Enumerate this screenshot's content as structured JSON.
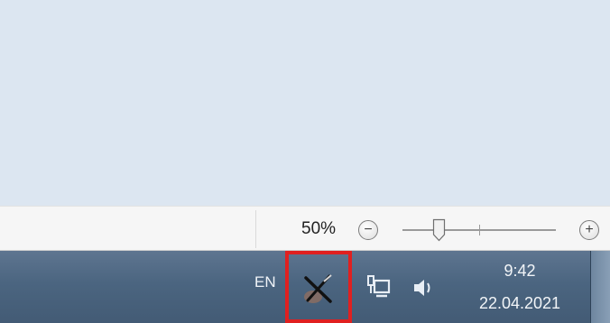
{
  "statusbar": {
    "zoom_percent": "50%",
    "zoom_out_symbol": "−",
    "zoom_in_symbol": "+",
    "zoom_level": 0.5
  },
  "taskbar": {
    "language": "EN",
    "tray_icons": [
      "tool-x-icon",
      "network-icon",
      "volume-icon"
    ],
    "clock": {
      "time": "9:42",
      "date": "22.04.2021"
    },
    "highlight_color": "#e02020"
  }
}
